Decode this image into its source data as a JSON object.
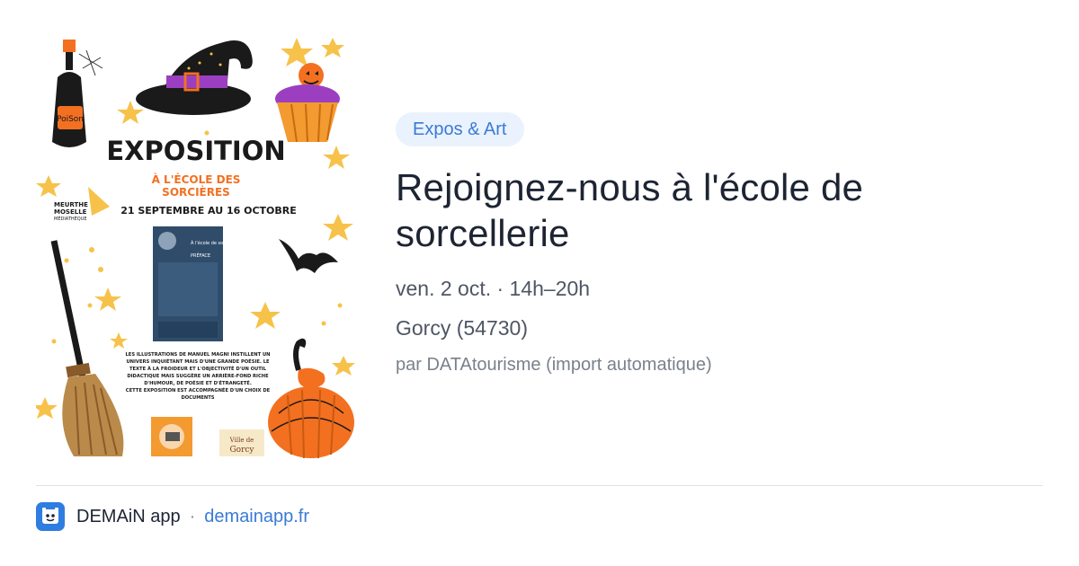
{
  "event": {
    "category": "Expos & Art",
    "title": "Rejoignez-nous à l'école de sorcellerie",
    "date_time": "ven. 2 oct. · 14h–20h",
    "location": "Gorcy (54730)",
    "source": "par DATAtourisme (import automatique)"
  },
  "poster": {
    "potion_label": "PoiSon",
    "heading": "EXPOSITION",
    "subheading_line1": "À L'ÉCOLE DES",
    "subheading_line2": "SORCIÈRES",
    "dates": "21 SEPTEMBRE AU 16 OCTOBRE",
    "org_line1": "MEURTHE",
    "org_line2": "MOSELLE",
    "org_line3": "MÉDIATHÈQUE",
    "book_title": "À l'école de sorcière",
    "book_subtitle": "PRÉFACE",
    "desc_line1": "LES ILLUSTRATIONS DE MANUEL MAGNI INSTILLENT UN",
    "desc_line2": "UNIVERS INQUIÉTANT MAIS D'UNE GRANDE POÉSIE. LE",
    "desc_line3": "TEXTE À LA FROIDEUR ET L'OBJECTIVITÉ D'UN OUTIL",
    "desc_line4": "DIDACTIQUE MAIS SUGGÈRE UN ARRIÈRE-FOND RICHE",
    "desc_line5": "D'HUMOUR, DE POÉSIE ET D'ÉTRANGETÉ.",
    "desc_line6": "CETTE EXPOSITION EST ACCOMPAGNÉE D'UN CHOIX DE",
    "desc_line7": "DOCUMENTS",
    "town_line1": "Ville de",
    "town_line2": "Gorcy"
  },
  "footer": {
    "app_name": "DEMAiN app",
    "separator": "·",
    "url": "demainapp.fr"
  },
  "colors": {
    "accent": "#3a7bd5",
    "badge_bg": "#eaf2fd",
    "title": "#1d2433",
    "meta": "#4f5663",
    "source": "#7a818c",
    "star": "#f7c24a",
    "pumpkin": "#f37021",
    "purple": "#9b3fc0"
  }
}
